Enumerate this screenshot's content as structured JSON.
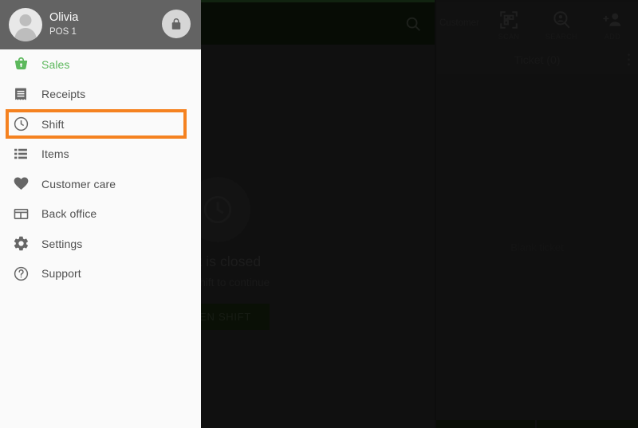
{
  "app_bar": {
    "search_icon": "search-icon"
  },
  "main": {
    "empty_state": {
      "icon": "clock-icon",
      "title": "Shift is closed",
      "subtitle": "Open shift to continue",
      "button_label": "OPEN SHIFT"
    }
  },
  "ticket_panel": {
    "customer_label": "Customer",
    "actions": [
      {
        "icon": "qr-scan-icon",
        "label": "SCAN"
      },
      {
        "icon": "search-person-icon",
        "label": "SEARCH"
      },
      {
        "icon": "person-add-icon",
        "label": "ADD"
      }
    ],
    "ticket_title": "Ticket (0)",
    "overflow_icon": "kebab-menu-icon",
    "body_text": "Blank ticket"
  },
  "drawer": {
    "user": {
      "avatar_icon": "avatar-icon",
      "name": "Olivia",
      "subtitle": "POS 1"
    },
    "lock_icon": "lock-icon",
    "items": [
      {
        "icon": "basket-icon",
        "label": "Sales",
        "active": true,
        "highlighted": false
      },
      {
        "icon": "receipt-icon",
        "label": "Receipts",
        "active": false,
        "highlighted": false
      },
      {
        "icon": "clock-icon",
        "label": "Shift",
        "active": false,
        "highlighted": true
      },
      {
        "icon": "list-icon",
        "label": "Items",
        "active": false,
        "highlighted": false
      },
      {
        "icon": "heart-icon",
        "label": "Customer care",
        "active": false,
        "highlighted": false
      },
      {
        "icon": "back-office-icon",
        "label": "Back office",
        "active": false,
        "highlighted": false
      },
      {
        "icon": "gear-icon",
        "label": "Settings",
        "active": false,
        "highlighted": false
      },
      {
        "icon": "help-circle-icon",
        "label": "Support",
        "active": false,
        "highlighted": false
      }
    ]
  },
  "colors": {
    "highlight": "#f58220",
    "accent_green": "#5cb85c",
    "app_bar": "#13200f",
    "drawer_header": "#636363"
  }
}
